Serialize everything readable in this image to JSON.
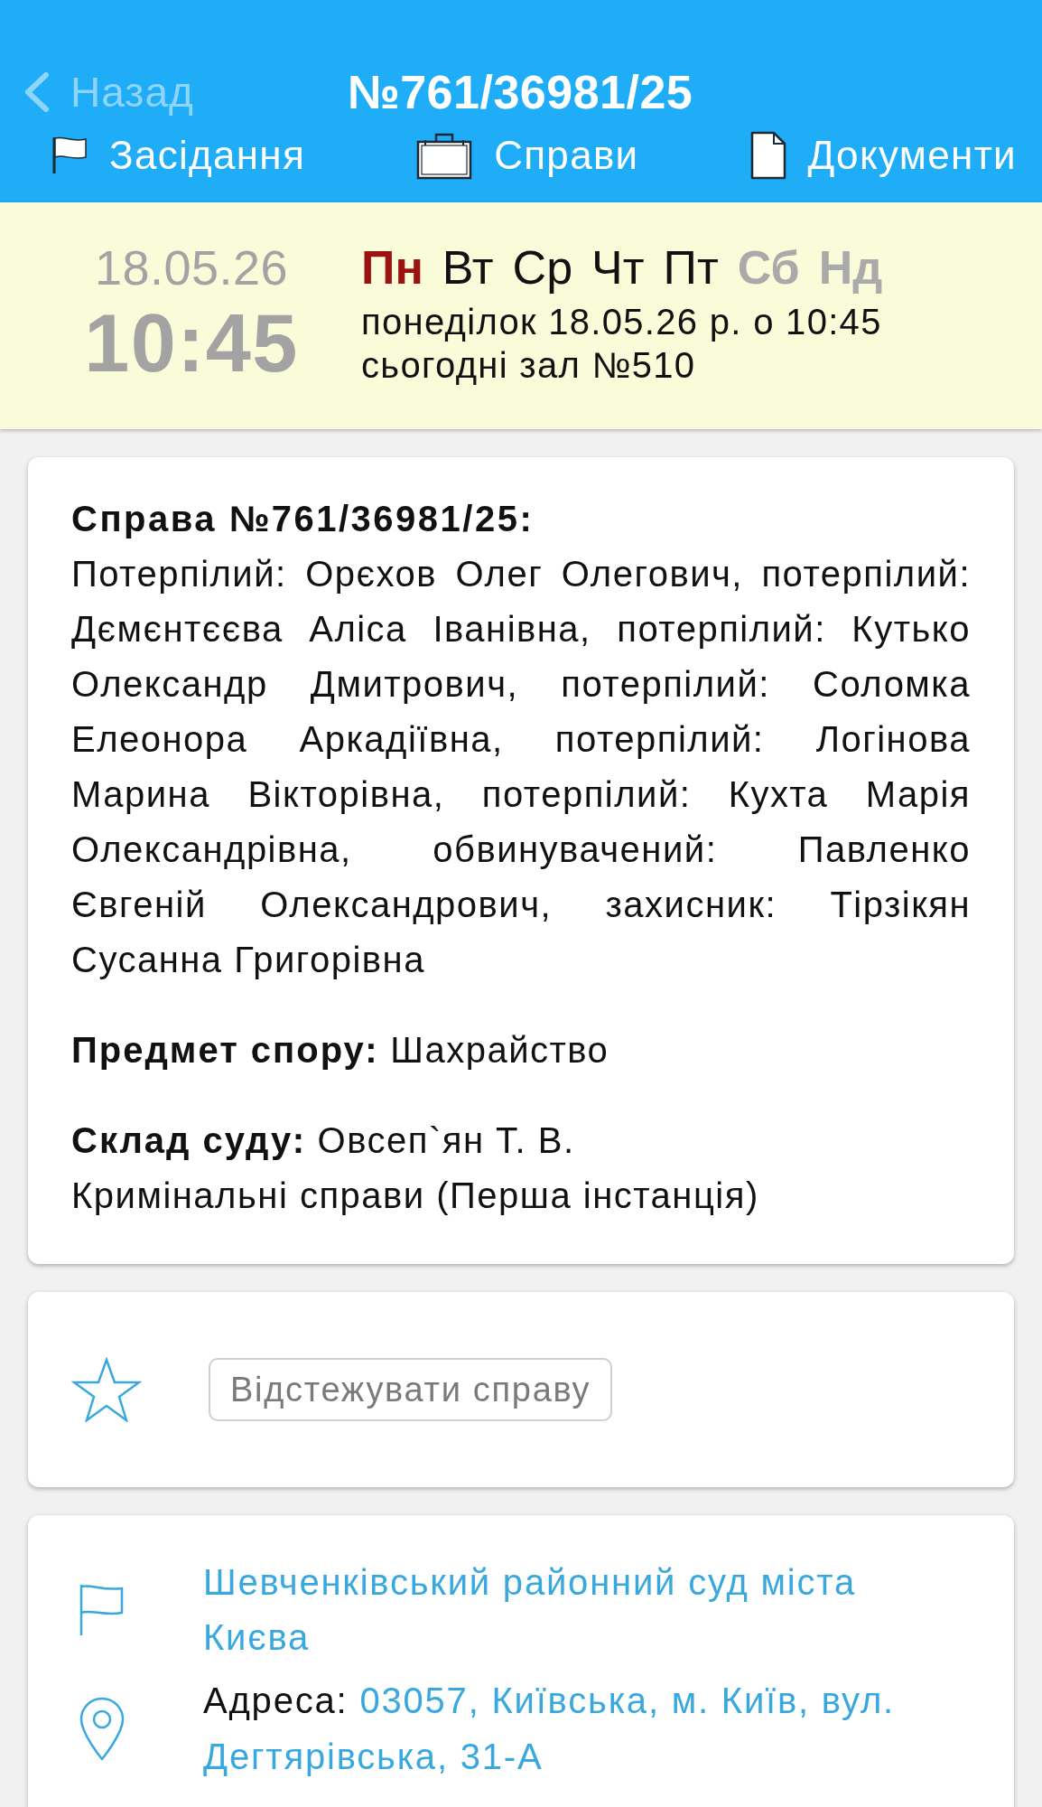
{
  "nav_bar": {
    "back_label": "Назад",
    "title": "№761/36981/25",
    "tabs": [
      {
        "label": "Засідання"
      },
      {
        "label": "Справи"
      },
      {
        "label": "Документи"
      }
    ]
  },
  "hearing": {
    "date": "18.05.26",
    "time": "10:45",
    "weekdays": [
      {
        "label": "Пн",
        "selected": true,
        "weekend": false
      },
      {
        "label": "Вт",
        "selected": false,
        "weekend": false
      },
      {
        "label": "Ср",
        "selected": false,
        "weekend": false
      },
      {
        "label": "Чт",
        "selected": false,
        "weekend": false
      },
      {
        "label": "Пт",
        "selected": false,
        "weekend": false
      },
      {
        "label": "Сб",
        "selected": false,
        "weekend": true
      },
      {
        "label": "Нд",
        "selected": false,
        "weekend": true
      }
    ],
    "datetime_text": "понеділок 18.05.26 р. о 10:45",
    "room_text": "сьогодні зал №510"
  },
  "case_card": {
    "title": "Справа №761/36981/25:",
    "participants": "Потерпілий: Орєхов Олег Олегович, потерпілий: Дємєнтєєва Аліса Іванівна, потерпілий: Кутько Олександр Дмитрович, потерпілий: Соломка Елеонора Аркадіївна, потерпілий: Логінова Марина Вікторівна, потерпілий: Кухта Марія Олександрівна, обвинувачений: Павленко Євгеній Олександрович, захисник: Тірзікян Сусанна Григорівна",
    "fields": [
      {
        "label": "Предмет спору:",
        "value": "Шахрайство"
      },
      {
        "label": "Склад суду:",
        "value": "Овсеп`ян Т. В."
      }
    ],
    "category": "Кримінальні справи (Перша інстанція)"
  },
  "track_card": {
    "starred": false,
    "button_label": "Відстежувати справу"
  },
  "court_card": {
    "court_name": "Шевченківський районний суд міста Києва",
    "address_label": "Адреса:",
    "address": "03057, Київська, м. Київ, вул. Дегтярівська, 31-А"
  }
}
